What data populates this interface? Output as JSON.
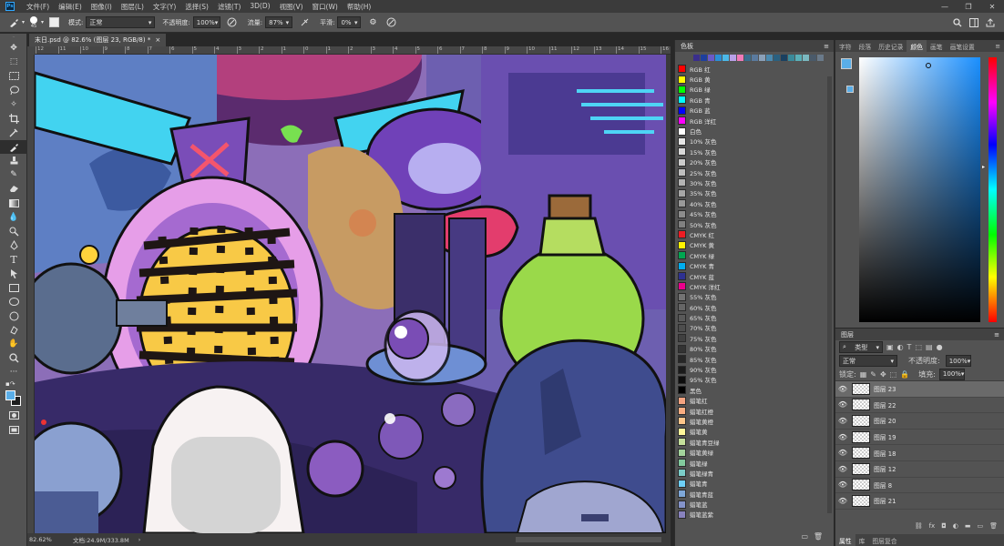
{
  "app": {
    "logo": "Ps"
  },
  "menu": [
    "文件(F)",
    "编辑(E)",
    "图像(I)",
    "图层(L)",
    "文字(Y)",
    "选择(S)",
    "滤镜(T)",
    "3D(D)",
    "视图(V)",
    "窗口(W)",
    "帮助(H)"
  ],
  "window_controls": [
    "—",
    "❐",
    "✕"
  ],
  "options": {
    "brush_size": "45",
    "mode_label": "模式:",
    "mode_value": "正常",
    "opacity_label": "不透明度:",
    "opacity_value": "100%",
    "flow_label": "流量:",
    "flow_value": "87%",
    "smooth_label": "平滑:",
    "smooth_value": "0%"
  },
  "document": {
    "tab_title": "末日.psd @ 82.6% (图层 23, RGB/8) *",
    "close": "×"
  },
  "ruler_ticks": [
    "12",
    "11",
    "10",
    "9",
    "8",
    "7",
    "6",
    "5",
    "4",
    "3",
    "2",
    "1",
    "0",
    "1",
    "2",
    "3",
    "4",
    "5",
    "6",
    "7",
    "8",
    "9",
    "10",
    "11",
    "12",
    "13",
    "14",
    "15",
    "16"
  ],
  "status": {
    "zoom": "82.62%",
    "doc": "文档:24.9M/333.8M"
  },
  "swatches_panel": {
    "title": "色板",
    "top_colors": [
      "#3a2e8c",
      "#1e3f9e",
      "#6a5ac8",
      "#2b8fd6",
      "#4bb8e8",
      "#b8a0e8",
      "#f07ab8",
      "#3a6e8e",
      "#5a7a9e",
      "#8aa0b8",
      "#4a8ab0",
      "#2a6080",
      "#1a4060",
      "#3a8a9a",
      "#5ab0b8",
      "#7ab8c0",
      "#4a5a6a",
      "#6a7a8a"
    ],
    "items": [
      {
        "color": "#ff0000",
        "name": "RGB 红"
      },
      {
        "color": "#ffff00",
        "name": "RGB 黄"
      },
      {
        "color": "#00ff00",
        "name": "RGB 绿"
      },
      {
        "color": "#00ffff",
        "name": "RGB 青"
      },
      {
        "color": "#0000ff",
        "name": "RGB 蓝"
      },
      {
        "color": "#ff00ff",
        "name": "RGB 洋红"
      },
      {
        "color": "#ffffff",
        "name": "白色"
      },
      {
        "color": "#e6e6e6",
        "name": "10% 灰色"
      },
      {
        "color": "#d9d9d9",
        "name": "15% 灰色"
      },
      {
        "color": "#cccccc",
        "name": "20% 灰色"
      },
      {
        "color": "#bfbfbf",
        "name": "25% 灰色"
      },
      {
        "color": "#b3b3b3",
        "name": "30% 灰色"
      },
      {
        "color": "#a6a6a6",
        "name": "35% 灰色"
      },
      {
        "color": "#999999",
        "name": "40% 灰色"
      },
      {
        "color": "#8c8c8c",
        "name": "45% 灰色"
      },
      {
        "color": "#808080",
        "name": "50% 灰色"
      },
      {
        "color": "#ed1c24",
        "name": "CMYK 红"
      },
      {
        "color": "#fff200",
        "name": "CMYK 黄"
      },
      {
        "color": "#00a651",
        "name": "CMYK 绿"
      },
      {
        "color": "#00aeef",
        "name": "CMYK 青"
      },
      {
        "color": "#2e3192",
        "name": "CMYK 蓝"
      },
      {
        "color": "#ec008c",
        "name": "CMYK 洋红"
      },
      {
        "color": "#737373",
        "name": "55% 灰色"
      },
      {
        "color": "#666666",
        "name": "60% 灰色"
      },
      {
        "color": "#595959",
        "name": "65% 灰色"
      },
      {
        "color": "#4d4d4d",
        "name": "70% 灰色"
      },
      {
        "color": "#404040",
        "name": "75% 灰色"
      },
      {
        "color": "#333333",
        "name": "80% 灰色"
      },
      {
        "color": "#262626",
        "name": "85% 灰色"
      },
      {
        "color": "#1a1a1a",
        "name": "90% 灰色"
      },
      {
        "color": "#0d0d0d",
        "name": "95% 灰色"
      },
      {
        "color": "#000000",
        "name": "黑色"
      },
      {
        "color": "#f4a380",
        "name": "蜡笔红"
      },
      {
        "color": "#f9ad81",
        "name": "蜡笔红橙"
      },
      {
        "color": "#fdc68a",
        "name": "蜡笔黄橙"
      },
      {
        "color": "#fff79a",
        "name": "蜡笔黄"
      },
      {
        "color": "#c4df9b",
        "name": "蜡笔青豆绿"
      },
      {
        "color": "#a3d39c",
        "name": "蜡笔黄绿"
      },
      {
        "color": "#82ca9d",
        "name": "蜡笔绿"
      },
      {
        "color": "#7bcdc8",
        "name": "蜡笔绿青"
      },
      {
        "color": "#6ecff6",
        "name": "蜡笔青"
      },
      {
        "color": "#7ea7d8",
        "name": "蜡笔青蓝"
      },
      {
        "color": "#8493ca",
        "name": "蜡笔蓝"
      },
      {
        "color": "#8882be",
        "name": "蜡笔蓝紫"
      }
    ]
  },
  "color_panel": {
    "tabs": [
      "字符",
      "段落",
      "历史记录",
      "颜色",
      "画笔",
      "画笔设置"
    ],
    "active_tab": "颜色",
    "foreground": "#5aaee8",
    "background": "#1e1e1e",
    "hue_base": "#1a8fff"
  },
  "layers_panel": {
    "title": "图层",
    "filter_label": "类型",
    "blend_mode": "正常",
    "opacity_label": "不透明度:",
    "opacity_value": "100%",
    "lock_label": "锁定:",
    "fill_label": "填充:",
    "fill_value": "100%",
    "layers": [
      "图层 23",
      "图层 22",
      "图层 20",
      "图层 19",
      "图层 18",
      "图层 12",
      "图层 8",
      "图层 21"
    ],
    "selected": "图层 23",
    "bottom_tabs": [
      "属性",
      "库",
      "图层复合"
    ]
  }
}
